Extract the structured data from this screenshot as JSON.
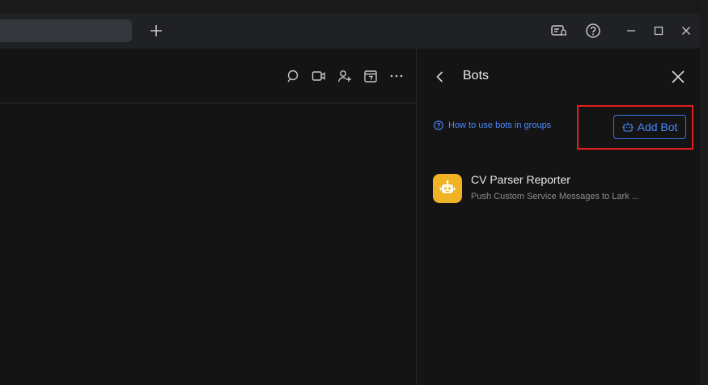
{
  "titlebar": {
    "icons": [
      "notification-settings-icon",
      "help-icon",
      "minimize-icon",
      "maximize-icon",
      "close-icon"
    ],
    "new_tab_icon": "plus-icon"
  },
  "chat_header": {
    "icons": [
      "search-chat-icon",
      "video-call-icon",
      "add-member-icon",
      "calendar-icon",
      "more-icon"
    ]
  },
  "side_panel": {
    "title": "Bots",
    "help_link": "How to use bots in groups",
    "add_bot_label": "Add Bot",
    "bots": [
      {
        "name": "CV Parser Reporter",
        "description": "Push Custom Service Messages to Lark ..."
      }
    ]
  },
  "colors": {
    "accent": "#4c88ff",
    "bot_avatar": "#f0b323",
    "highlight": "#e21e1e"
  }
}
